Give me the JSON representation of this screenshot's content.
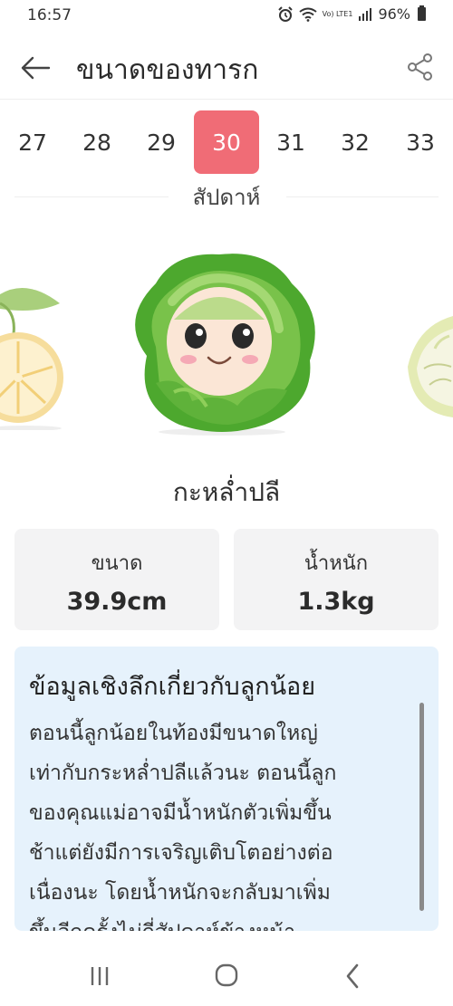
{
  "status_bar": {
    "time": "16:57",
    "lte_label": "Vo) LTE1",
    "battery": "96%"
  },
  "app_bar": {
    "title": "ขนาดของทารก"
  },
  "weeks": {
    "items": [
      "27",
      "28",
      "29",
      "30",
      "31",
      "32",
      "33"
    ],
    "selected": "30",
    "unit_label": "สัปดาห์"
  },
  "produce": {
    "name": "กะหล่ำปลี",
    "size_label": "ขนาด",
    "size_value": "39.9cm",
    "weight_label": "น้ำหนัก",
    "weight_value": "1.3kg"
  },
  "insight": {
    "title": "ข้อมูลเชิงลึกเกี่ยวกับลูกน้อย",
    "lines": [
      "ตอนนี้ลูกน้อยในท้องมีขนาดใหญ่",
      "เท่ากับกระหล่ำปลีแล้วนะ ตอนนี้ลูก",
      "ของคุณแม่อาจมีน้ำหนักตัวเพิ่มขึ้น",
      "ช้าแต่ยังมีการเจริญเติบโตอย่างต่อ",
      "เนื่องนะ โดยน้ำหนักจะกลับมาเพิ่ม",
      "ขึ้นอีกครั้งไม่กี่สัปดาห์ข้างหน้า"
    ]
  },
  "colors": {
    "accent": "#f06c76",
    "insight_bg": "#e6f2fc",
    "card_bg": "#f3f3f4"
  }
}
